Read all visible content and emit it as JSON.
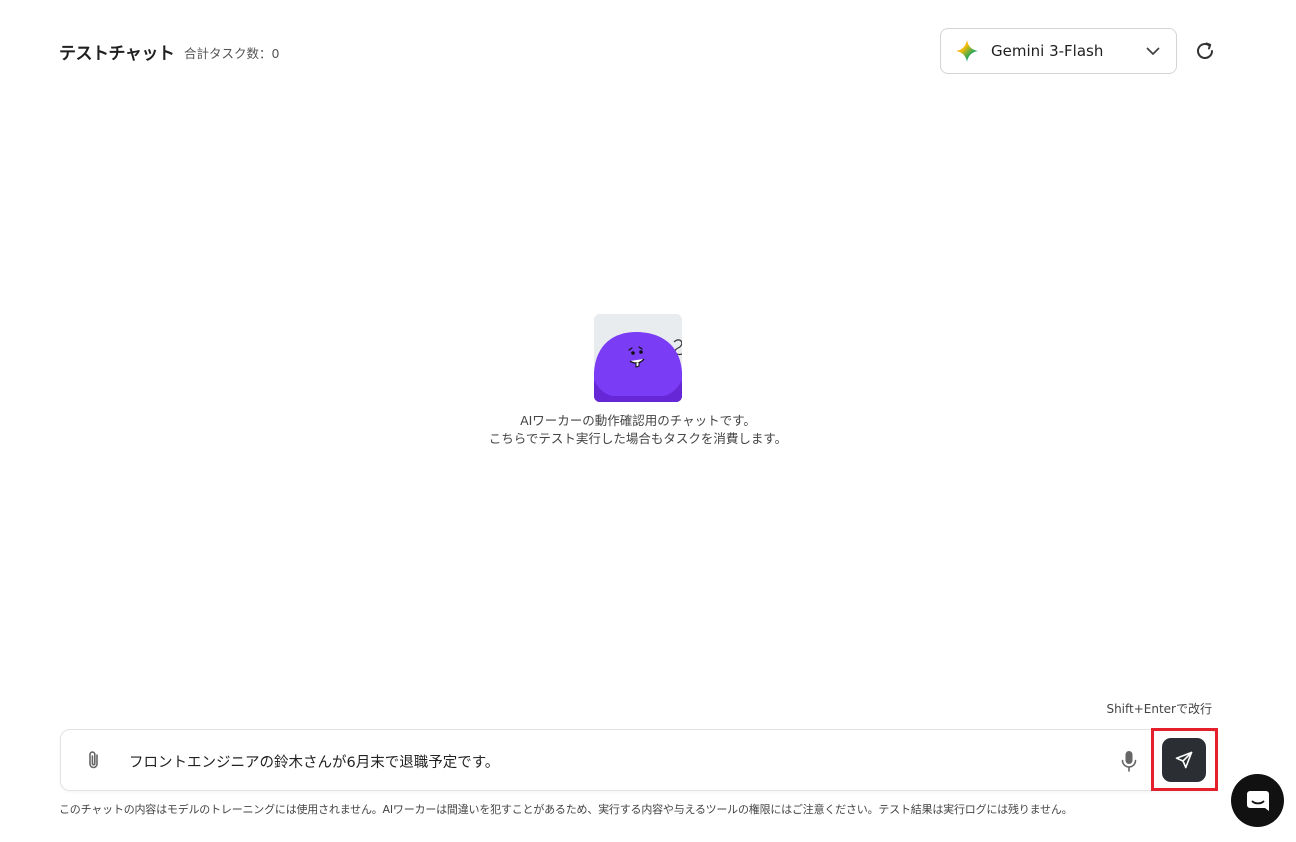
{
  "header": {
    "title": "テストチャット",
    "task_count": "合計タスク数：0",
    "model_name": "Gemini 3-Flash"
  },
  "empty_state": {
    "line1": "AIワーカーの動作確認用のチャットです。",
    "line2": "こちらでテスト実行した場合もタスクを消費します。"
  },
  "composer": {
    "hint": "Shift+Enterで改行",
    "message": "フロントエンジニアの鈴木さんが6月末で退職予定です。"
  },
  "footer": {
    "disclaimer": "このチャットの内容はモデルのトレーニングには使用されません。AIワーカーは間違いを犯すことがあるため、実行する内容や与えるツールの権限にはご注意ください。テスト結果は実行ログには残りません。"
  },
  "colors": {
    "mascot": "#7b3cf5",
    "send_button": "#2b2f33",
    "highlight": "#e4202c"
  },
  "icons": [
    "gemini-star-icon",
    "chevron-down-icon",
    "refresh-icon",
    "paperclip-icon",
    "microphone-icon",
    "send-icon",
    "chat-bubble-icon"
  ]
}
